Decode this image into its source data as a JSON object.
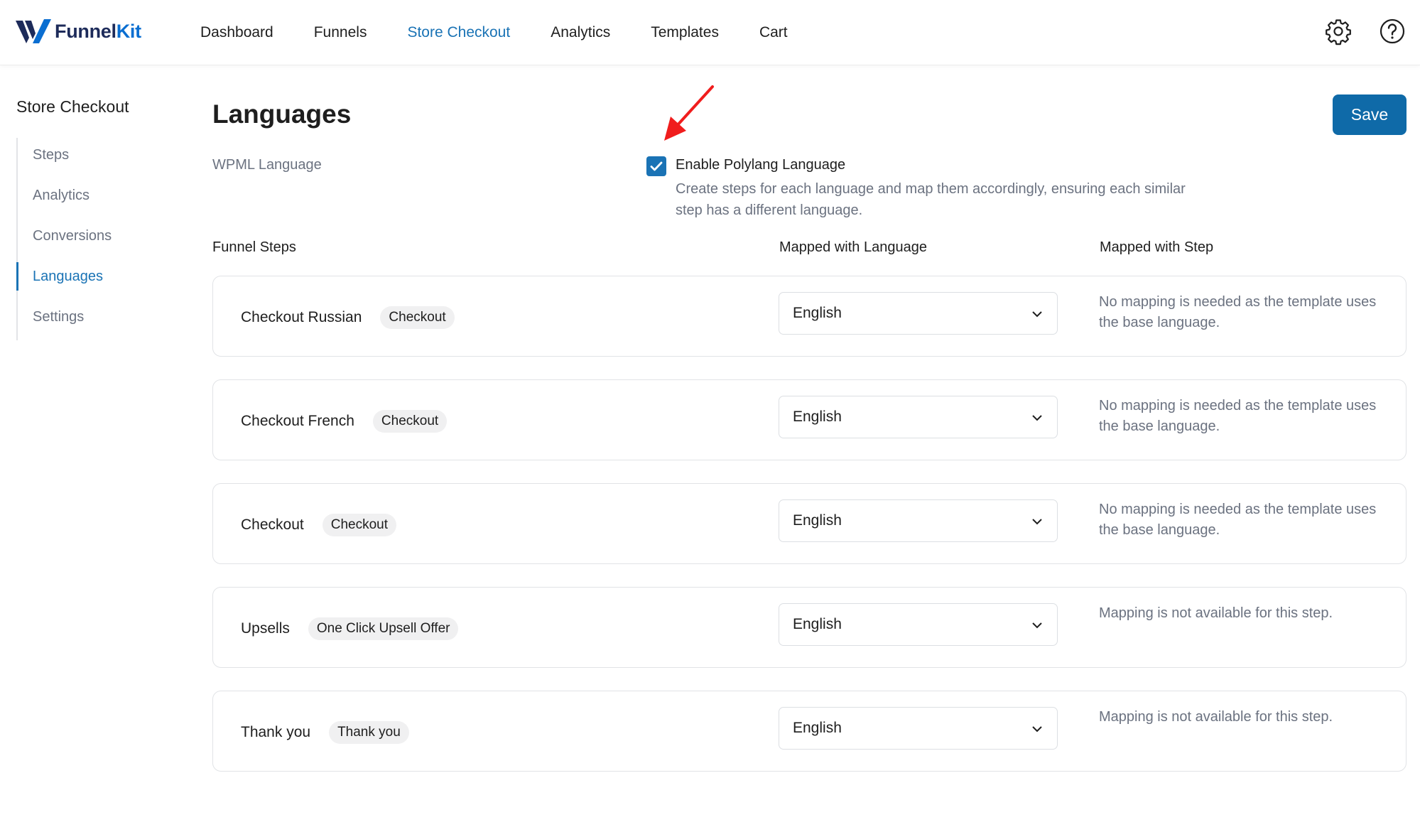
{
  "brand": {
    "name_part1": "Funnel",
    "name_part2": "Kit",
    "accent": "#1a73b5"
  },
  "nav": {
    "items": [
      {
        "label": "Dashboard"
      },
      {
        "label": "Funnels"
      },
      {
        "label": "Store Checkout",
        "active": true
      },
      {
        "label": "Analytics"
      },
      {
        "label": "Templates"
      },
      {
        "label": "Cart"
      }
    ],
    "icons": [
      "gear-icon",
      "help-icon"
    ]
  },
  "sidebar": {
    "title": "Store Checkout",
    "items": [
      {
        "label": "Steps"
      },
      {
        "label": "Analytics"
      },
      {
        "label": "Conversions"
      },
      {
        "label": "Languages",
        "active": true
      },
      {
        "label": "Settings"
      }
    ]
  },
  "main": {
    "title": "Languages",
    "save_label": "Save",
    "wpml_label": "WPML Language",
    "polylang": {
      "checked": true,
      "label": "Enable Polylang Language",
      "description": "Create steps for each language and map them accordingly, ensuring each similar step has a different language."
    },
    "columns": {
      "steps": "Funnel Steps",
      "language": "Mapped with Language",
      "step": "Mapped with Step"
    },
    "rows": [
      {
        "name": "Checkout Russian",
        "badge": "Checkout",
        "language": "English",
        "note": "No mapping is needed as the template uses the base language."
      },
      {
        "name": "Checkout French",
        "badge": "Checkout",
        "language": "English",
        "note": "No mapping is needed as the template uses the base language."
      },
      {
        "name": "Checkout",
        "badge": "Checkout",
        "language": "English",
        "note": "No mapping is needed as the template uses the base language."
      },
      {
        "name": "Upsells",
        "badge": "One Click Upsell Offer",
        "language": "English",
        "note": "Mapping is not available for this step."
      },
      {
        "name": "Thank you",
        "badge": "Thank you",
        "language": "English",
        "note": "Mapping is not available for this step."
      }
    ]
  }
}
